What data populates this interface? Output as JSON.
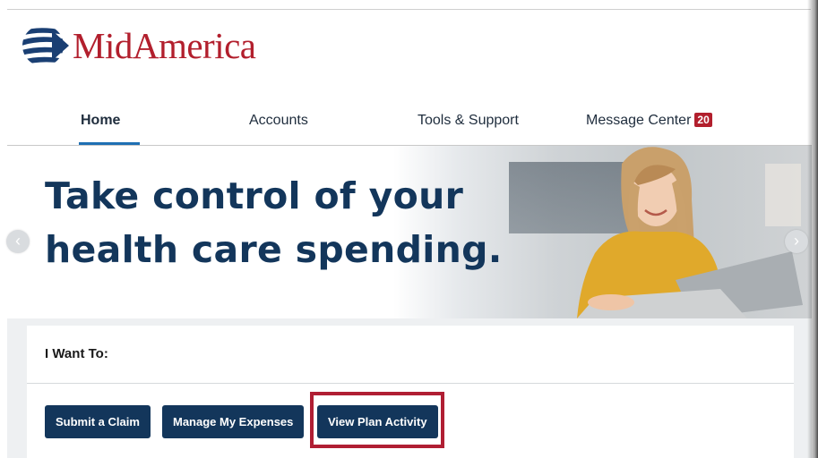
{
  "brand": {
    "name": "MidAmerica",
    "color": "#b21f2d",
    "mark_color": "#1a3f73"
  },
  "nav": {
    "items": [
      {
        "label": "Home",
        "active": true
      },
      {
        "label": "Accounts"
      },
      {
        "label": "Tools & Support"
      },
      {
        "label": "Message Center"
      }
    ],
    "message_count": "20"
  },
  "hero": {
    "headline_line1": "Take control of your",
    "headline_line2": "health care spending.",
    "prev_icon": "chevron-left-icon",
    "next_icon": "chevron-right-icon"
  },
  "actions": {
    "title": "I Want To:",
    "buttons": [
      {
        "label": "Submit a Claim"
      },
      {
        "label": "Manage My Expenses"
      },
      {
        "label": "View Plan Activity",
        "highlighted": true
      }
    ]
  },
  "colors": {
    "primary": "#13365b",
    "accent_underline": "#1f6fb3",
    "highlight": "#b01e33"
  }
}
